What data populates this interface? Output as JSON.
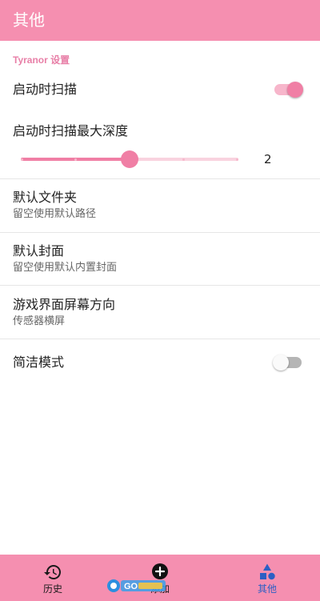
{
  "appbar": {
    "title": "其他"
  },
  "section": {
    "header": "Tyranor 设置"
  },
  "settings": {
    "scan_on_start": {
      "label": "启动时扫描",
      "enabled": true
    },
    "scan_depth": {
      "label": "启动时扫描最大深度",
      "value": "2",
      "min": 0,
      "max": 4,
      "current": 2
    },
    "default_folder": {
      "title": "默认文件夹",
      "subtitle": "留空使用默认路径"
    },
    "default_cover": {
      "title": "默认封面",
      "subtitle": "留空使用默认内置封面"
    },
    "game_orientation": {
      "title": "游戏界面屏幕方向",
      "subtitle": "传感器横屏"
    },
    "simple_mode": {
      "label": "简洁模式",
      "enabled": false
    }
  },
  "bottom_nav": {
    "items": [
      {
        "label": "历史",
        "icon": "history-icon"
      },
      {
        "label": "添加",
        "icon": "add-icon"
      },
      {
        "label": "其他",
        "icon": "shapes-icon",
        "active": true
      }
    ]
  },
  "colors": {
    "primary": "#f58fb0",
    "accent": "#f07fa5",
    "active_nav": "#2c5fc4"
  },
  "watermark": {
    "text": "GO"
  }
}
